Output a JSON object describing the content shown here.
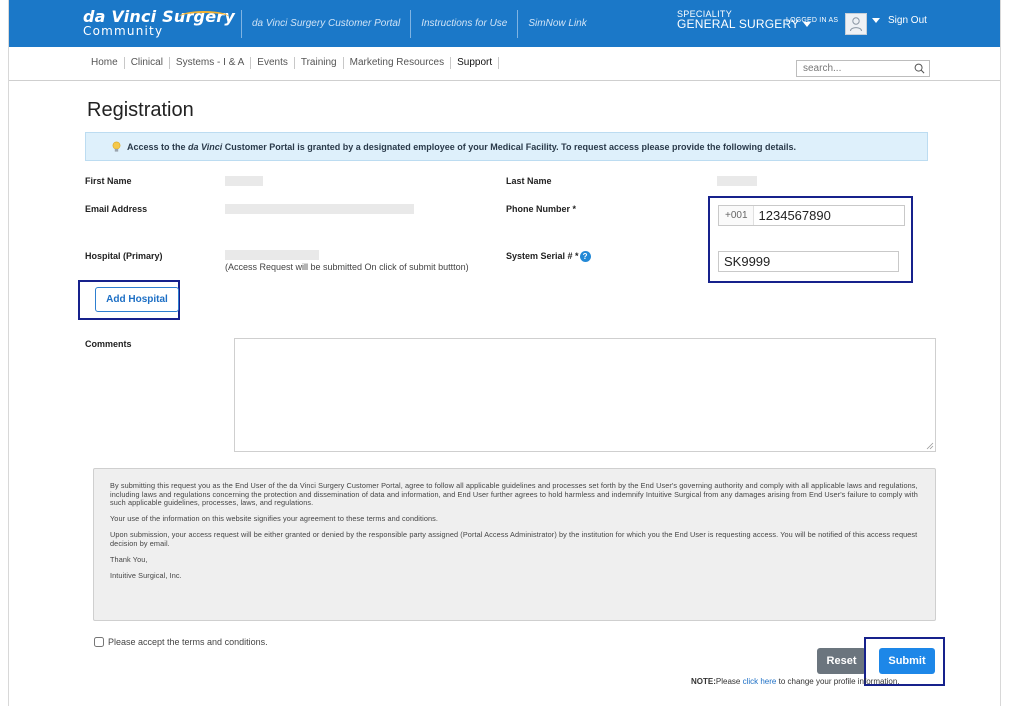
{
  "header": {
    "logo_main": "da Vinci Surgery",
    "logo_sub": "Community",
    "links": [
      "da Vinci Surgery Customer Portal",
      "Instructions for Use",
      "SimNow Link"
    ],
    "speciality_label": "SPECIALITY",
    "speciality_value": "GENERAL SURGERY",
    "logged_in_label": "LOGGED IN AS",
    "sign_out": "Sign Out"
  },
  "nav": {
    "items": [
      "Home",
      "Clinical",
      "Systems - I & A",
      "Events",
      "Training",
      "Marketing Resources",
      "Support"
    ],
    "active": "Support",
    "search_placeholder": "search..."
  },
  "page": {
    "title": "Registration",
    "notice_prefix": "Access to the ",
    "notice_italic": "da Vinci",
    "notice_suffix": " Customer Portal is granted by a designated employee of your Medical Facility. To request access please provide the following details."
  },
  "form": {
    "first_name_label": "First Name",
    "last_name_label": "Last Name",
    "email_label": "Email Address",
    "phone_label": "Phone Number *",
    "phone_prefix": "+001",
    "phone_value": "1234567890",
    "hospital_label": "Hospital (Primary)",
    "hospital_note": "(Access Request will be submitted On click of submit buttton)",
    "serial_label": "System Serial # *",
    "serial_value": "SK9999",
    "add_hospital": "Add Hospital",
    "comments_label": "Comments"
  },
  "terms": {
    "p1": "By submitting this request you as the End User of the da Vinci Surgery Customer Portal, agree to follow all applicable guidelines and processes set forth by the End User's governing authority and comply with all applicable laws and regulations, including laws and regulations concerning the protection and dissemination of data and information, and End User further agrees to hold harmless and indemnify Intuitive Surgical from any damages arising from End User's failure to comply with such applicable guidelines, processes, laws, and regulations.",
    "p2": "Your use of the information on this website signifies your agreement to these terms and conditions.",
    "p3": "Upon submission, your access request will be either granted or denied by the responsible party assigned (Portal Access Administrator) by the institution for which you the End User is requesting access. You will be notified of this access request decision by email.",
    "p4": "Thank You,",
    "p5": "Intuitive Surgical, Inc."
  },
  "footer": {
    "accept_label": "Please accept the terms and conditions.",
    "reset": "Reset",
    "submit": "Submit",
    "note_label": "NOTE:",
    "note_pre": "Please ",
    "note_link": "click here",
    "note_post": " to change your profile information."
  }
}
